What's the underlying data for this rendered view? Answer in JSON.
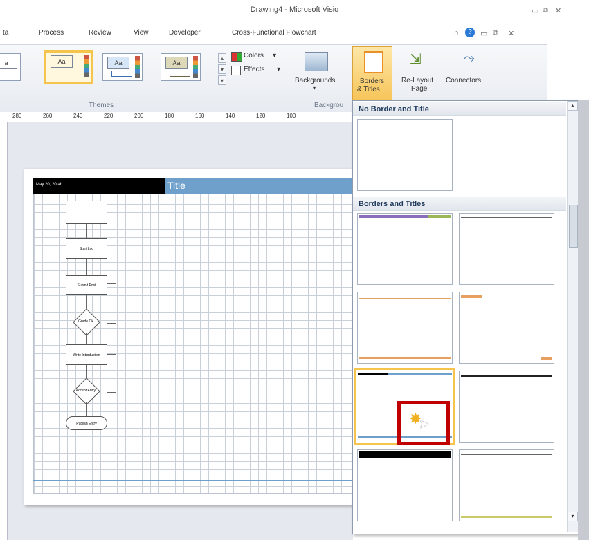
{
  "window": {
    "title": "Drawing4 - Microsoft Visio"
  },
  "tabs": [
    "ta",
    "Process",
    "Review",
    "View",
    "Developer",
    "Cross-Functional Flowchart"
  ],
  "ribbon": {
    "colors_label": "Colors",
    "effects_label": "Effects",
    "backgrounds_label": "Backgrounds",
    "borders_label_1": "Borders",
    "borders_label_2": "& Titles",
    "relayout_label_1": "Re-Layout",
    "relayout_label_2": "Page",
    "connectors_label": "Connectors",
    "themes_group": "Themes",
    "backgrounds_group": "Backgrou",
    "theme_aa": "Aa",
    "theme_partial": "a"
  },
  "ruler": {
    "ticks": [
      "280",
      "260",
      "240",
      "220",
      "200",
      "180",
      "160",
      "140",
      "120",
      "100"
    ]
  },
  "page": {
    "title": "Title",
    "date": "May 20, 20 ab",
    "shapes": [
      "",
      "Start Log",
      "Submit Post",
      "Grade Ok",
      "Write Introduction",
      "Accept Entry",
      "Publish Entry"
    ]
  },
  "gallery": {
    "section1": "No Border and Title",
    "section2": "Borders and Titles"
  },
  "colors": {
    "accent": "#6fa0cc",
    "highlight": "#c00000",
    "selected": "#f5c44c"
  }
}
